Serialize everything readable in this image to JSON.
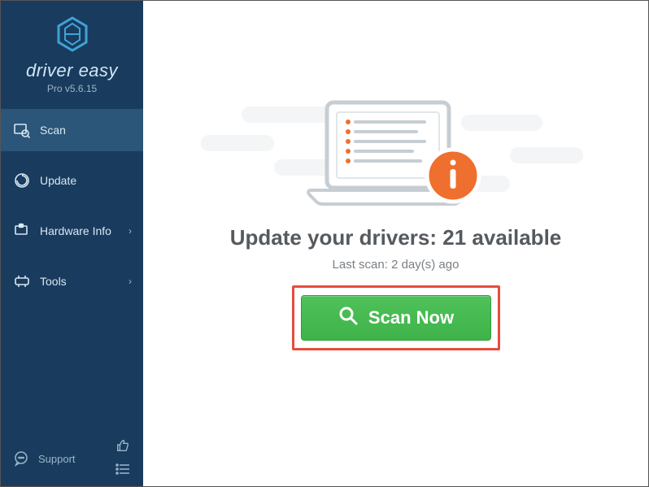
{
  "app": {
    "brand_top": "driver easy",
    "brand_sub": "Pro v5.6.15"
  },
  "sidebar": {
    "items": [
      {
        "label": "Scan"
      },
      {
        "label": "Update"
      },
      {
        "label": "Hardware Info"
      },
      {
        "label": "Tools"
      }
    ],
    "support_label": "Support"
  },
  "main": {
    "headline_prefix": "Update your drivers: ",
    "available_count": "21",
    "headline_suffix": " available",
    "last_scan_prefix": "Last scan: ",
    "last_scan_value": "2 day(s) ago",
    "scan_button": "Scan Now"
  }
}
